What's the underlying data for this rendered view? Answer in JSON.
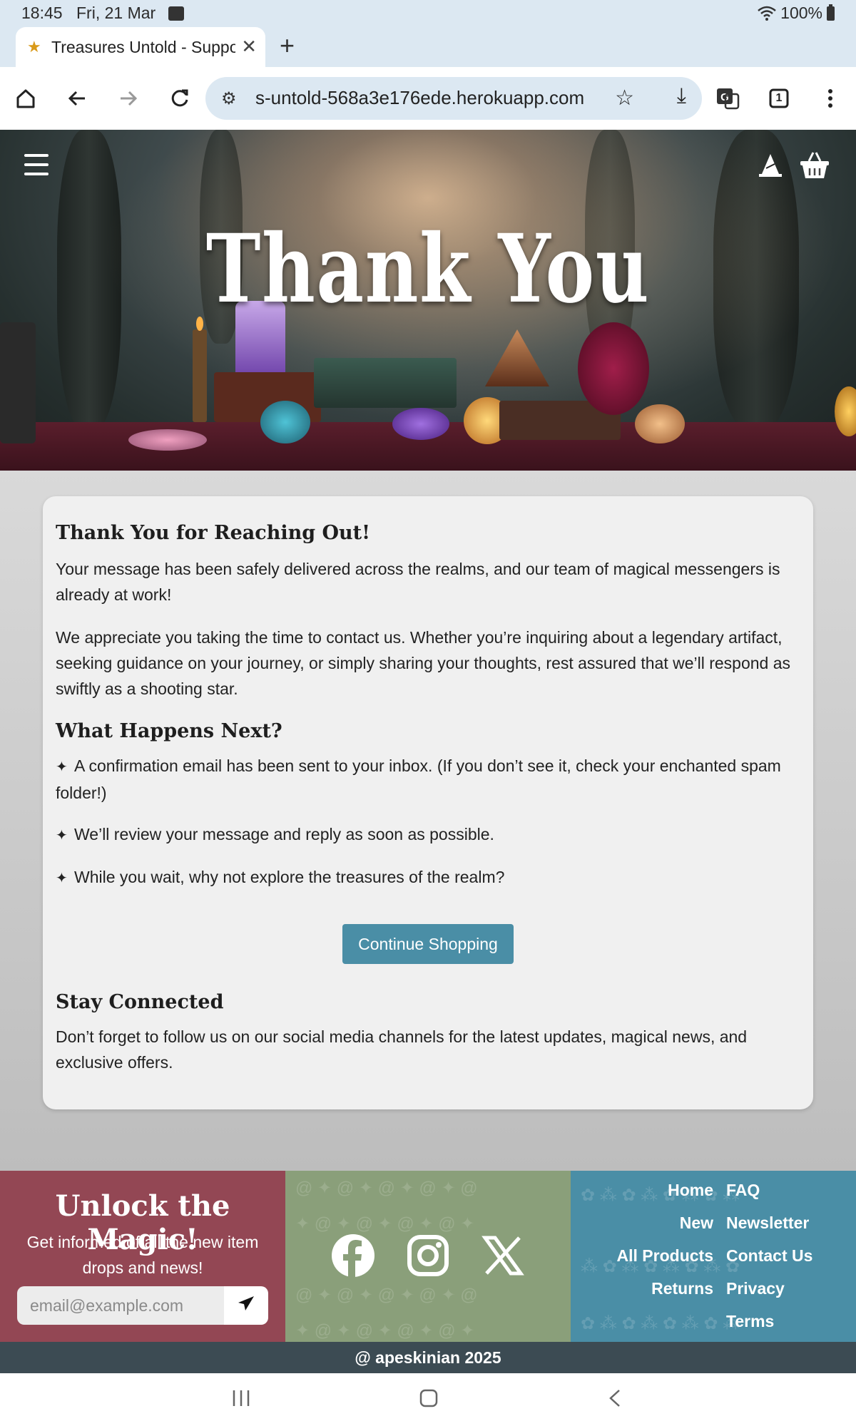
{
  "status_bar": {
    "time": "18:45",
    "date": "Fri, 21 Mar",
    "battery": "100%"
  },
  "browser": {
    "tab_title": "Treasures Untold - Support",
    "url": "s-untold-568a3e176ede.herokuapp.com",
    "tab_count": "1"
  },
  "hero": {
    "title": "Thank You"
  },
  "content": {
    "heading1": "Thank You for Reaching Out!",
    "para1": "Your message has been safely delivered across the realms, and our team of magical messengers is already at work!",
    "para2": "We appreciate you taking the time to contact us. Whether you’re inquiring about a legendary artifact, seeking guidance on your journey, or simply sharing your thoughts, rest assured that we’ll respond as swiftly as a shooting star.",
    "heading2": "What Happens Next?",
    "item1": "A confirmation email has been sent to your inbox. (If you don’t see it, check your enchanted spam folder!)",
    "item2": "We’ll review your message and reply as soon as possible.",
    "item3": "While you wait, why not explore the treasures of the realm?",
    "button": "Continue Shopping",
    "heading3": "Stay Connected",
    "para3": "Don’t forget to follow us on our social media channels for the latest updates, magical news, and exclusive offers."
  },
  "footer": {
    "newsletter_title": "Unlock the Magic!",
    "newsletter_text": "Get informed of all the new item drops and news!",
    "email_placeholder": "email@example.com",
    "links_left": [
      "Home",
      "New",
      "All Products",
      "Returns"
    ],
    "links_right": [
      "FAQ",
      "Newsletter",
      "Contact Us",
      "Privacy",
      "Terms"
    ],
    "copyright": "@ apeskinian 2025"
  },
  "colors": {
    "accent_button": "#4a8ea6",
    "footer_red": "#934754",
    "footer_green": "#8a9f7a",
    "footer_blue": "#4a8ea6",
    "copyright_bar": "#3c4b53"
  },
  "icons": [
    "gallery-icon",
    "wifi-icon",
    "battery-icon",
    "favicon-icon",
    "close-icon",
    "plus-icon",
    "home-icon",
    "back-icon",
    "forward-icon",
    "reload-icon",
    "site-settings-icon",
    "star-icon",
    "download-icon",
    "translate-icon",
    "tab-count-icon",
    "more-icon",
    "menu-icon",
    "wizard-hat-icon",
    "basket-icon",
    "magic-wand-icon",
    "send-icon",
    "facebook-icon",
    "instagram-icon",
    "x-icon",
    "recents-icon",
    "home-nav-icon",
    "back-nav-icon"
  ]
}
